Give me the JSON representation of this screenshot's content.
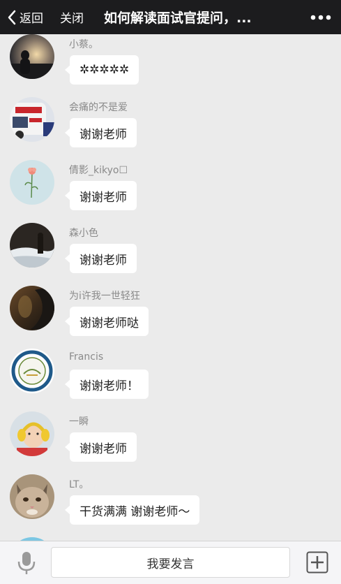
{
  "navbar": {
    "back_label": "返回",
    "close_label": "关闭",
    "title": "如何解读面试官提问，..."
  },
  "messages": [
    {
      "sender": "小蔡。",
      "text": "✲✲✲✲✲",
      "avatar": "avatar-sunset-silhouette"
    },
    {
      "sender": "会痛的不是爱",
      "text": "谢谢老师",
      "avatar": "avatar-bus-photo"
    },
    {
      "sender": "倩影_kikyo☐",
      "text": "谢谢老师",
      "avatar": "avatar-flower"
    },
    {
      "sender": "森小色",
      "text": "谢谢老师",
      "avatar": "avatar-snow-figure"
    },
    {
      "sender": "为i许我一世轻狂",
      "text": "谢谢老师哒",
      "avatar": "avatar-dark-photo"
    },
    {
      "sender": "Francis",
      "text": "谢谢老师！",
      "avatar": "avatar-university-seal"
    },
    {
      "sender": "一瞬",
      "text": "谢谢老师",
      "avatar": "avatar-child-headphones"
    },
    {
      "sender": "LT。",
      "text": "干货满满 谢谢老师～",
      "avatar": "avatar-cat"
    }
  ],
  "inputbar": {
    "placeholder": "我要发言",
    "voice_icon": "microphone-icon",
    "more_icon": "plus-box-icon"
  },
  "colors": {
    "navbar_bg": "#1c1c1e",
    "page_bg": "#ebebeb",
    "bubble_bg": "#ffffff",
    "sender_text": "#8a8a8a"
  }
}
